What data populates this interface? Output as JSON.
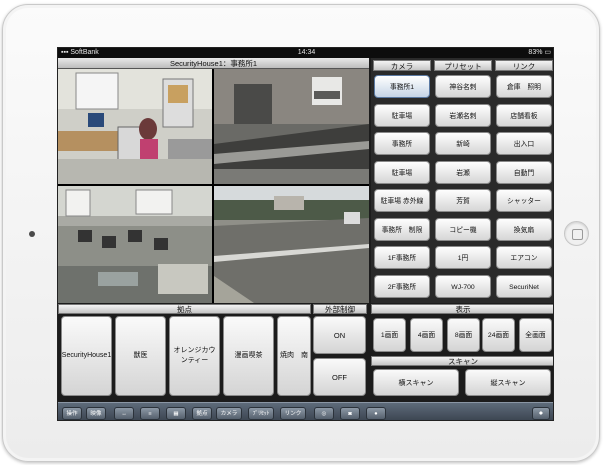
{
  "status_bar": {
    "carrier": "SoftBank",
    "time": "14:34",
    "battery": "83%"
  },
  "title": "SecurityHouse1：事務所1",
  "camera_header": "カメラ",
  "preset_header": "プリセット",
  "link_header": "リンク",
  "camera_buttons": [
    "事務所1",
    "駐車場",
    "事務所",
    "駐車場",
    "駐車場 赤外線",
    "事務所　制限",
    "1F事務所",
    "2F事務所"
  ],
  "preset_buttons": [
    "神谷名刺",
    "岩瀬名刺",
    "新崎",
    "岩瀬",
    "芳賀",
    "コピー機",
    "1円",
    "WJ-700"
  ],
  "link_buttons": [
    "倉庫　照明",
    "店舗看板",
    "出入口",
    "自動門",
    "シャッター",
    "換気扇",
    "エアコン",
    "SecuriNet"
  ],
  "sites_header": "拠点",
  "site_buttons": [
    "SecurityHouse1",
    "獣医",
    "オレンジカウンティー",
    "漫画喫茶",
    "焼肉　南"
  ],
  "external_header": "外部制御",
  "on_label": "ON",
  "off_label": "OFF",
  "display_header": "表示",
  "display_buttons": [
    "1画面",
    "4画面",
    "8画面",
    "24画面",
    "全画面"
  ],
  "scan_header": "スキャン",
  "scan_buttons": [
    "横スキャン",
    "縦スキャン"
  ],
  "toolbar_buttons": [
    "操作",
    "映像",
    "↔",
    "≡",
    "▦",
    "拠点",
    "カメラ",
    "ﾌﾟﾘｾｯﾄ",
    "リンク"
  ],
  "toolbar_icons": [
    "globe-icon",
    "camera-icon",
    "record-icon",
    "gear-icon"
  ],
  "accent_color": "#5b7aa3"
}
